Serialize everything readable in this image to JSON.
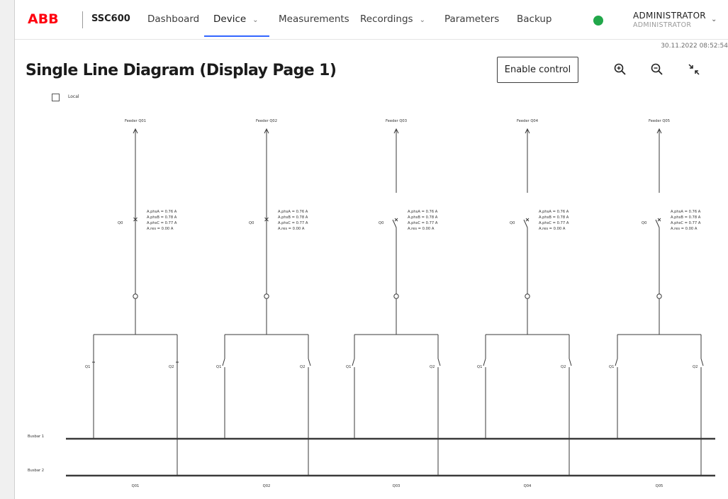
{
  "header": {
    "logo": "ABB",
    "product": "SSC600",
    "nav": [
      {
        "label": "Dashboard",
        "dropdown": false
      },
      {
        "label": "Device",
        "dropdown": true,
        "active": true
      },
      {
        "label": "Measurements",
        "dropdown": false
      },
      {
        "label": "Recordings",
        "dropdown": true
      },
      {
        "label": "Parameters",
        "dropdown": false
      },
      {
        "label": "Backup",
        "dropdown": false
      }
    ],
    "status_color": "#21a74a",
    "user": {
      "name": "ADMINISTRATOR",
      "role": "ADMINISTRATOR"
    }
  },
  "timestamp": "30.11.2022  08:52:54",
  "page": {
    "title": "Single Line Diagram (Display Page 1)",
    "enable_control_label": "Enable control",
    "tools": [
      "zoom-in-icon",
      "zoom-out-icon",
      "fit-to-screen-icon"
    ],
    "local_checkbox_label": "Local",
    "local_checked": false
  },
  "diagram": {
    "busbars": [
      "Busbar 1",
      "Busbar 2"
    ],
    "feeders": [
      {
        "name": "Feeder Q01",
        "bay": "Q01",
        "breaker": "Q0",
        "breaker_state": "closed",
        "left": {
          "label": "Q1",
          "state": "closed"
        },
        "right": {
          "label": "Q2",
          "state": "closed"
        },
        "meas": [
          "A.phsA = 0.76 A",
          "A.phsB = 0.78 A",
          "A.phsC = 0.77 A",
          "A.res = 0.00 A"
        ]
      },
      {
        "name": "Feeder Q02",
        "bay": "Q02",
        "breaker": "Q0",
        "breaker_state": "closed",
        "left": {
          "label": "Q1",
          "state": "open"
        },
        "right": {
          "label": "Q2",
          "state": "open"
        },
        "meas": [
          "A.phsA = 0.76 A",
          "A.phsB = 0.78 A",
          "A.phsC = 0.77 A",
          "A.res = 0.00 A"
        ]
      },
      {
        "name": "Feeder Q03",
        "bay": "Q03",
        "breaker": "Q0",
        "breaker_state": "open",
        "left": {
          "label": "Q1",
          "state": "open"
        },
        "right": {
          "label": "Q2",
          "state": "open"
        },
        "meas": [
          "A.phsA = 0.76 A",
          "A.phsB = 0.78 A",
          "A.phsC = 0.77 A",
          "A.res = 0.00 A"
        ]
      },
      {
        "name": "Feeder Q04",
        "bay": "Q04",
        "breaker": "Q0",
        "breaker_state": "open",
        "left": {
          "label": "Q1",
          "state": "open"
        },
        "right": {
          "label": "Q2",
          "state": "open"
        },
        "meas": [
          "A.phsA = 0.76 A",
          "A.phsB = 0.78 A",
          "A.phsC = 0.77 A",
          "A.res = 0.00 A"
        ]
      },
      {
        "name": "Feeder Q05",
        "bay": "Q05",
        "breaker": "Q0",
        "breaker_state": "open",
        "left": {
          "label": "Q1",
          "state": "open"
        },
        "right": {
          "label": "Q2",
          "state": "open"
        },
        "meas": [
          "A.phsA = 0.76 A",
          "A.phsB = 0.78 A",
          "A.phsC = 0.77 A",
          "A.res = 0.00 A"
        ]
      }
    ]
  }
}
